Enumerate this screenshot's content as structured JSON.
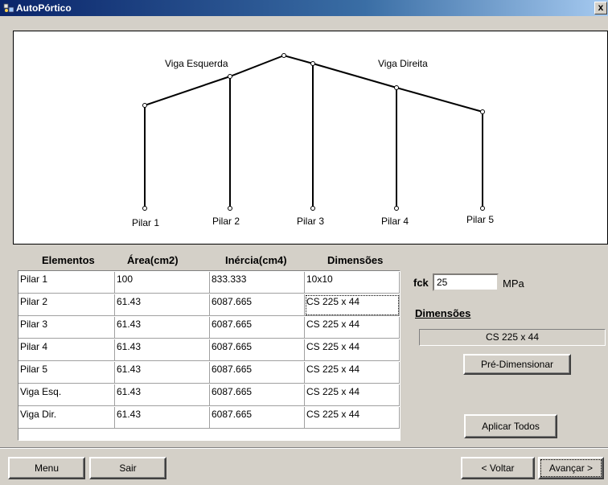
{
  "window": {
    "title": "AutoPórtico",
    "close_label": "x"
  },
  "diagram": {
    "labels": {
      "viga_esquerda": "Viga Esquerda",
      "viga_direita": "Viga Direita",
      "pilar1": "Pilar 1",
      "pilar2": "Pilar 2",
      "pilar3": "Pilar 3",
      "pilar4": "Pilar 4",
      "pilar5": "Pilar 5"
    }
  },
  "grid": {
    "headers": [
      "Elementos",
      "Área(cm2)",
      "Inércia(cm4)",
      "Dimensões"
    ],
    "rows": [
      [
        "Pilar 1",
        "100",
        "833.333",
        "10x10"
      ],
      [
        "Pilar 2",
        "61.43",
        "6087.665",
        "CS 225 x 44"
      ],
      [
        "Pilar 3",
        "61.43",
        "6087.665",
        "CS 225 x 44"
      ],
      [
        "Pilar 4",
        "61.43",
        "6087.665",
        "CS 225 x 44"
      ],
      [
        "Pilar 5",
        "61.43",
        "6087.665",
        "CS 225 x 44"
      ],
      [
        "Viga Esq.",
        "61.43",
        "6087.665",
        "CS 225 x 44"
      ],
      [
        "Viga Dir.",
        "61.43",
        "6087.665",
        "CS 225 x 44"
      ]
    ]
  },
  "fck": {
    "label": "fck",
    "value": "25",
    "unit": "MPa"
  },
  "dimensoes": {
    "label": "Dimensões",
    "value": "CS 225 x 44"
  },
  "buttons": {
    "pre_dimensionar": "Pré-Dimensionar",
    "aplicar_todos": "Aplicar Todos",
    "menu": "Menu",
    "sair": "Sair",
    "voltar": "< Voltar",
    "avancar": "Avançar >"
  }
}
